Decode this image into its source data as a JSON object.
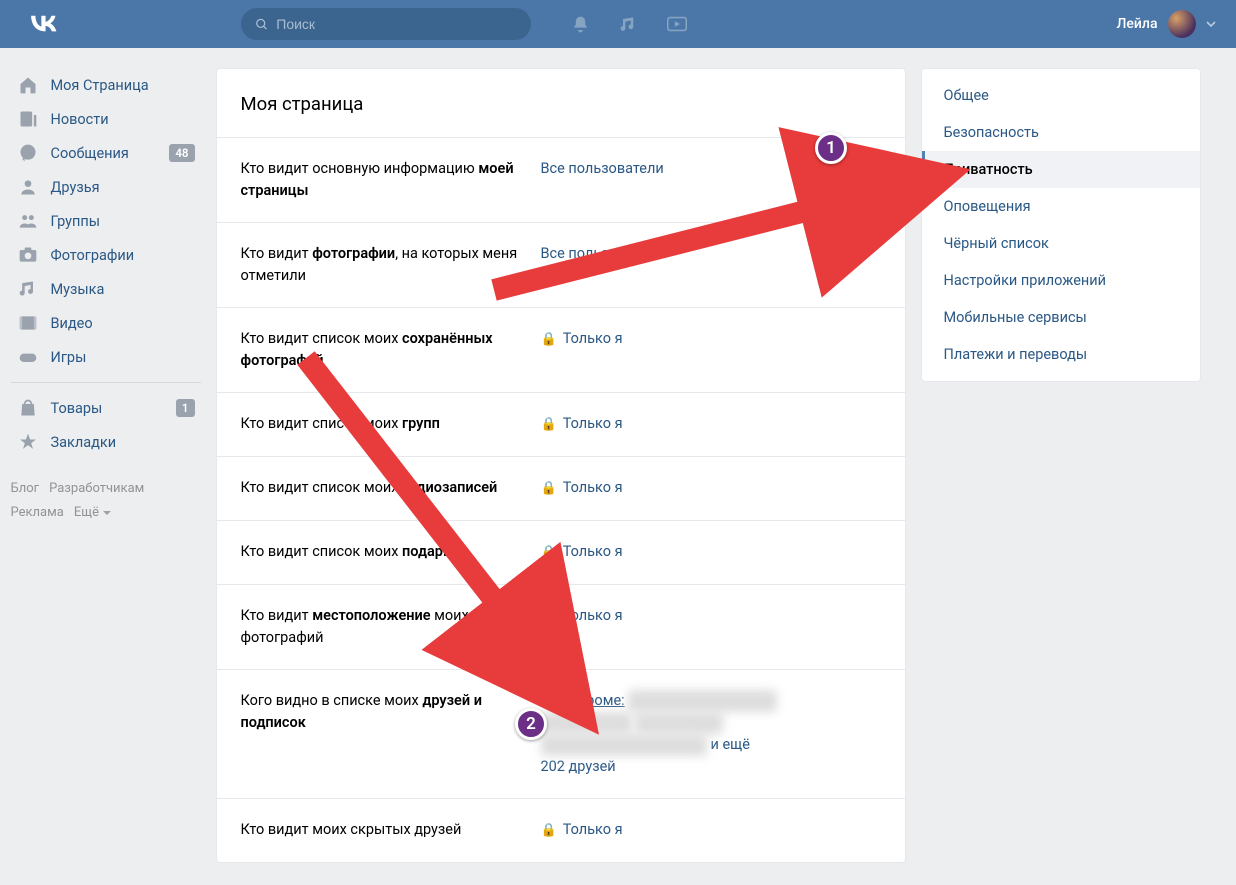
{
  "header": {
    "search_placeholder": "Поиск",
    "user_name": "Лейла"
  },
  "leftnav": {
    "items": [
      {
        "icon": "home",
        "label": "Моя Страница"
      },
      {
        "icon": "news",
        "label": "Новости"
      },
      {
        "icon": "msg",
        "label": "Сообщения",
        "badge": "48"
      },
      {
        "icon": "user",
        "label": "Друзья"
      },
      {
        "icon": "group",
        "label": "Группы"
      },
      {
        "icon": "photo",
        "label": "Фотографии"
      },
      {
        "icon": "music",
        "label": "Музыка"
      },
      {
        "icon": "video",
        "label": "Видео"
      },
      {
        "icon": "game",
        "label": "Игры"
      }
    ],
    "items2": [
      {
        "icon": "shop",
        "label": "Товары",
        "badge": "1"
      },
      {
        "icon": "star",
        "label": "Закладки"
      }
    ],
    "footer": {
      "blog": "Блог",
      "dev": "Разработчикам",
      "ads": "Реклама",
      "more": "Ещё"
    }
  },
  "main": {
    "title": "Моя страница",
    "rows": [
      {
        "label_html": "Кто видит основную информацию <strong>моей страницы</strong>",
        "value": "Все пользователи",
        "locked": false
      },
      {
        "label_html": "Кто видит <strong>фотографии</strong>, на которых меня отметили",
        "value": "Все пользователи",
        "locked": false
      },
      {
        "label_html": "Кто видит список моих <strong>сохранённых фотографий</strong>",
        "value": "Только я",
        "locked": true
      },
      {
        "label_html": "Кто видит список моих <strong>групп</strong>",
        "value": "Только я",
        "locked": true
      },
      {
        "label_html": "Кто видит список моих <strong>аудиозаписей</strong>",
        "value": "Только я",
        "locked": true
      },
      {
        "label_html": "Кто видит список моих <strong>подарков</strong>",
        "value": "Только я",
        "locked": true
      },
      {
        "label_html": "Кто видит <strong>местоположение</strong> моих фотографий",
        "value": "Только я",
        "locked": true
      },
      {
        "label_html": "Кого видно в списке моих <strong>друзей и подписок</strong>",
        "value_prefix": "Всех, кроме:",
        "value_suffix": "и ещё 202 друзей",
        "locked": false,
        "redacted": true
      },
      {
        "label_html": "Кто видит моих скрытых друзей",
        "value": "Только я",
        "locked": true
      }
    ]
  },
  "rightnav": {
    "items": [
      {
        "label": "Общее"
      },
      {
        "label": "Безопасность"
      },
      {
        "label": "Приватность",
        "active": true
      },
      {
        "label": "Оповещения"
      },
      {
        "label": "Чёрный список"
      },
      {
        "label": "Настройки приложений"
      },
      {
        "label": "Мобильные сервисы"
      },
      {
        "label": "Платежи и переводы"
      }
    ]
  },
  "annotations": {
    "marker1": "1",
    "marker2": "2"
  }
}
